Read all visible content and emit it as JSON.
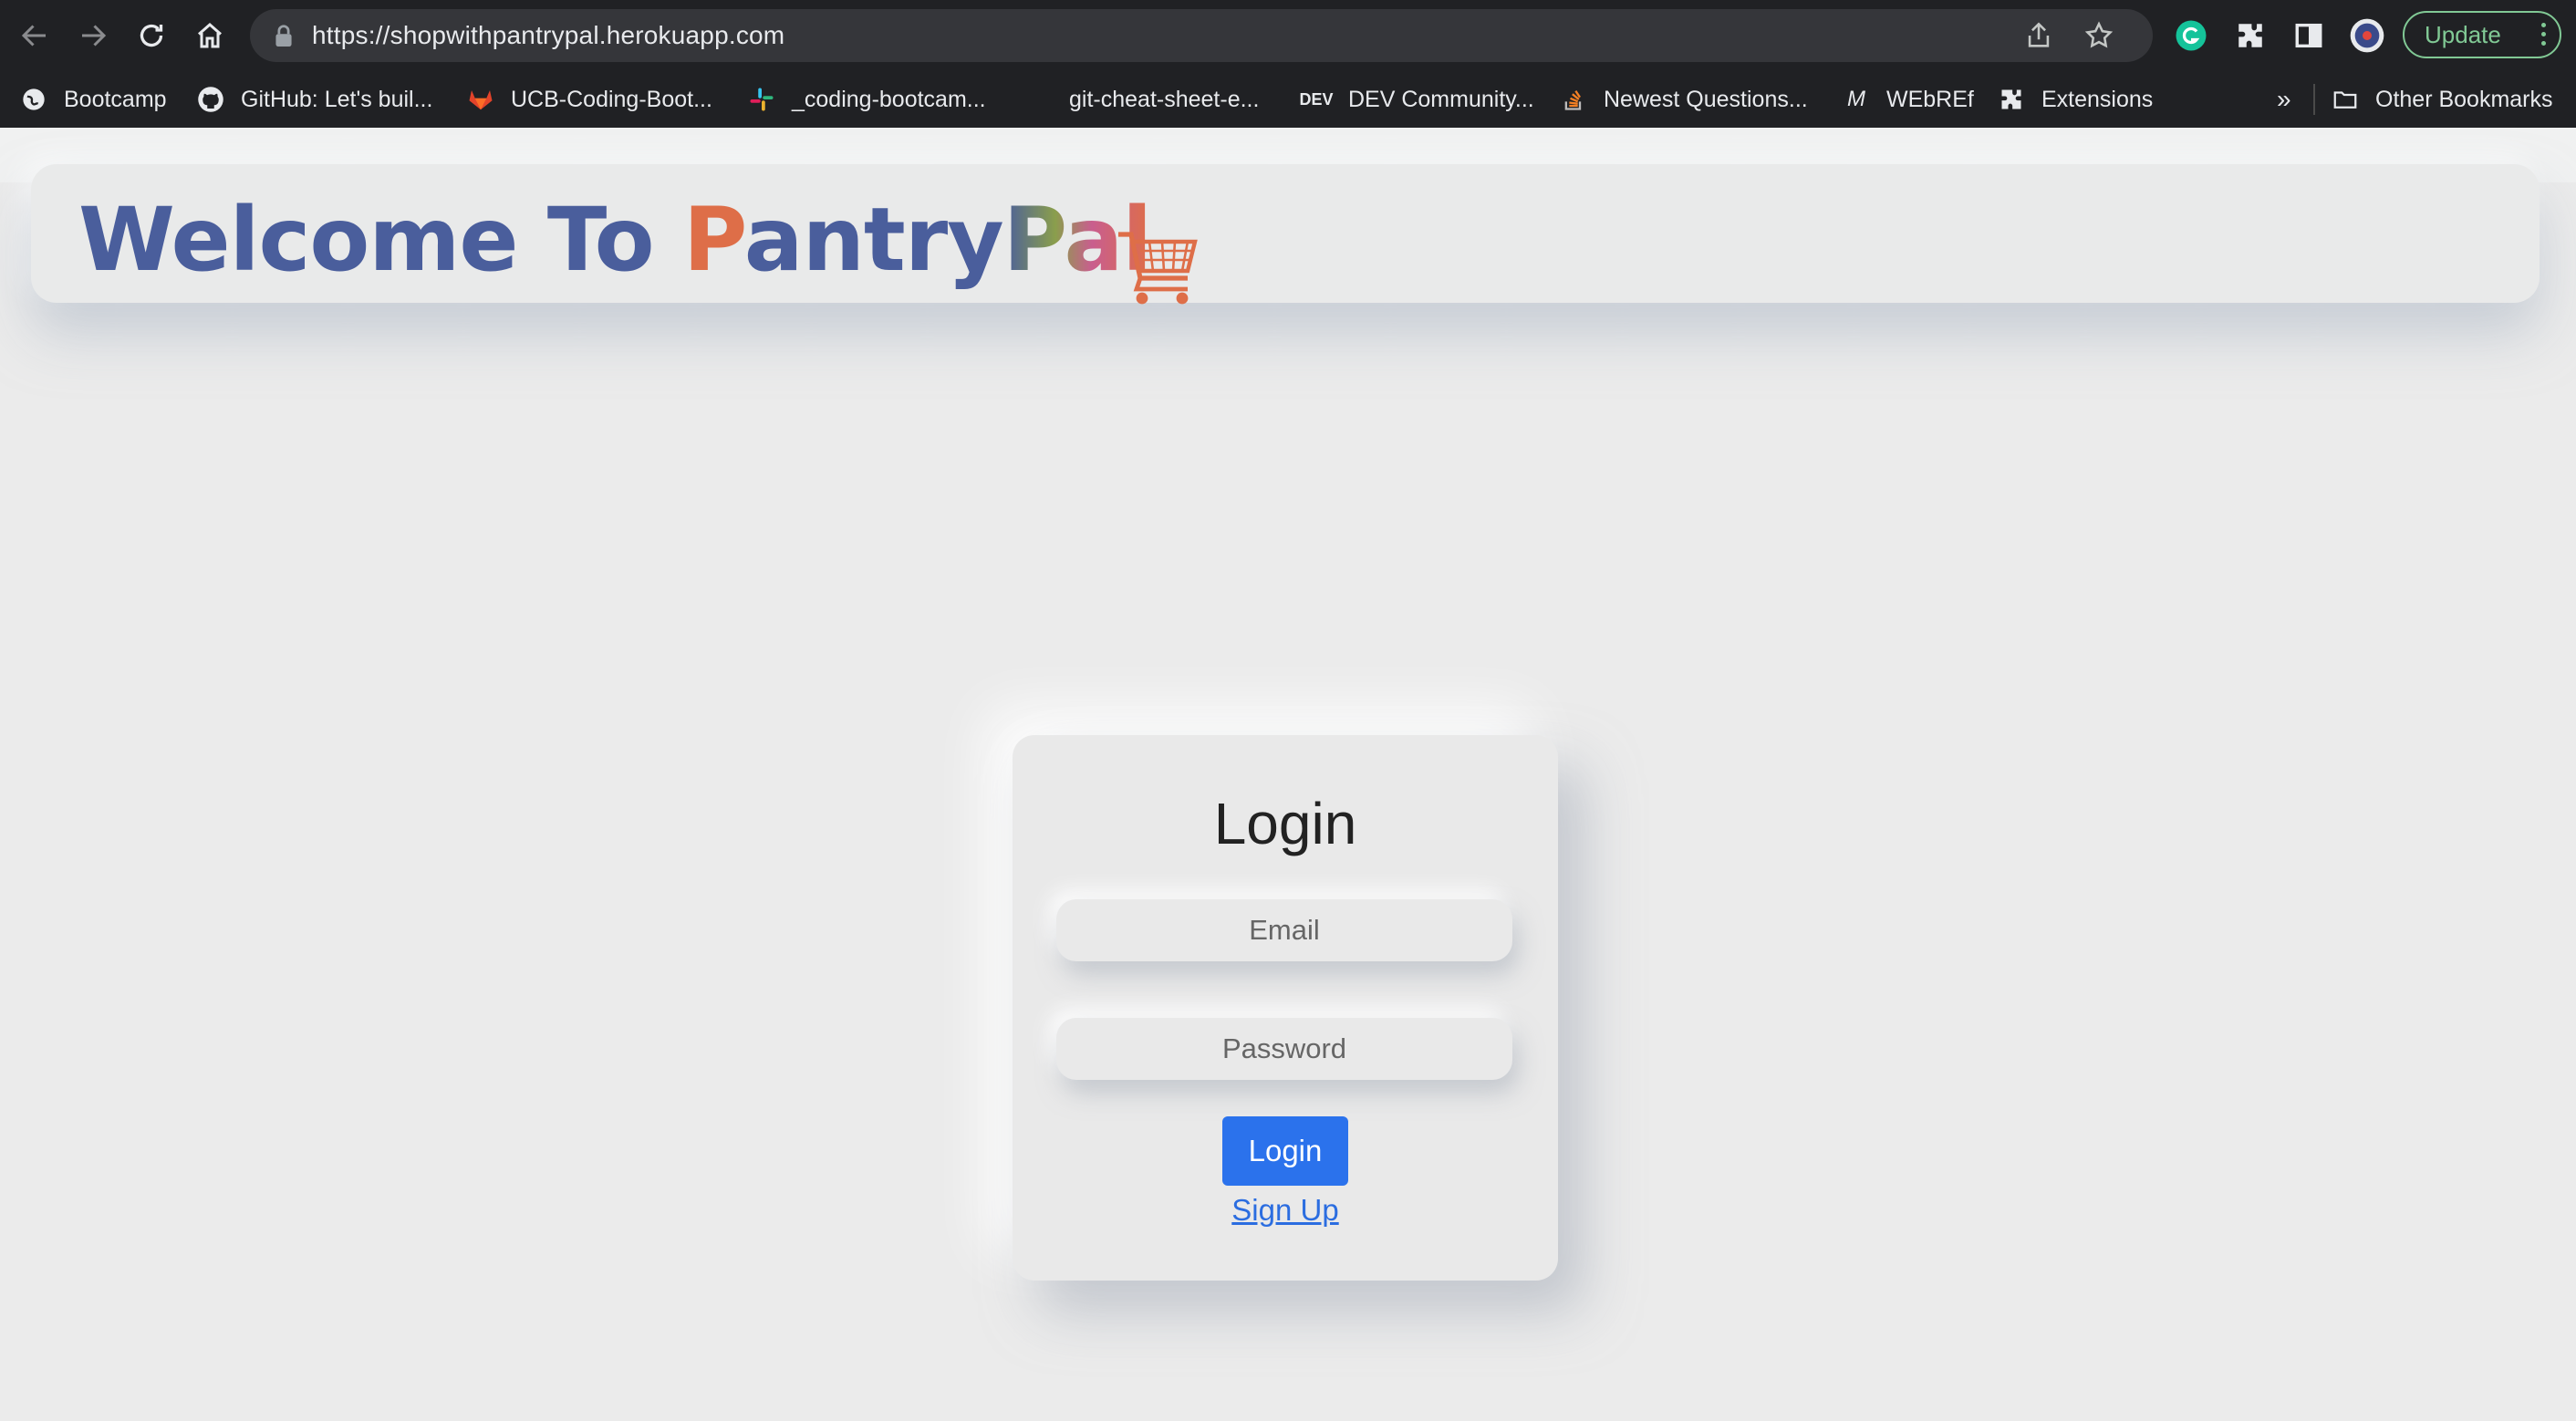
{
  "browser": {
    "url": "https://shopwithpantrypal.herokuapp.com",
    "update_label": "Update",
    "bookmarks": [
      {
        "label": "Bootcamp",
        "icon": "globe-icon"
      },
      {
        "label": "GitHub: Let's buil...",
        "icon": "github-icon"
      },
      {
        "label": "UCB-Coding-Boot...",
        "icon": "gitlab-icon"
      },
      {
        "label": "_coding-bootcam...",
        "icon": "slack-icon"
      },
      {
        "label": "git-cheat-sheet-e...",
        "icon": ""
      },
      {
        "label": "DEV Community...",
        "icon": "dev-icon"
      },
      {
        "label": "Newest Questions...",
        "icon": "stackoverflow-icon"
      },
      {
        "label": "WEbREf",
        "icon": "medium-icon"
      },
      {
        "label": "Extensions",
        "icon": "puzzle-icon"
      }
    ],
    "overflow_label": "»",
    "other_bookmarks_label": "Other Bookmarks",
    "dev_glyph": "DEV",
    "medium_glyph": "M"
  },
  "header": {
    "welcome_part1": "Welcome To ",
    "brand_part1": "P",
    "brand_part2": "antry",
    "brand_part3": "Pal"
  },
  "login": {
    "title": "Login",
    "email_placeholder": "Email",
    "password_placeholder": "Password",
    "submit_label": "Login",
    "signup_label": "Sign Up"
  },
  "colors": {
    "brand_blue": "#4a5e9c",
    "brand_orange": "#de6e48",
    "button_blue": "#2b72ec",
    "link_blue": "#2b6de0"
  }
}
